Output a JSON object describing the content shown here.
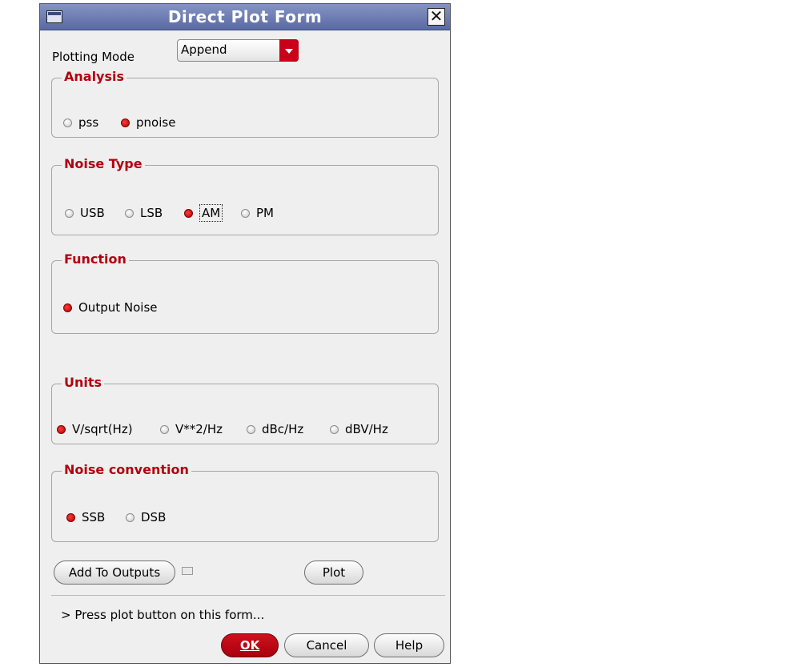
{
  "window": {
    "title": "Direct Plot Form",
    "close_symbol": "✕"
  },
  "plotting_mode": {
    "label": "Plotting Mode",
    "value": "Append"
  },
  "analysis": {
    "title": "Analysis",
    "options": [
      {
        "label": "pss",
        "selected": false
      },
      {
        "label": "pnoise",
        "selected": true
      }
    ]
  },
  "noise_type": {
    "title": "Noise Type",
    "options": [
      {
        "label": "USB",
        "selected": false
      },
      {
        "label": "LSB",
        "selected": false
      },
      {
        "label": "AM",
        "selected": true
      },
      {
        "label": "PM",
        "selected": false
      }
    ]
  },
  "function": {
    "title": "Function",
    "options": [
      {
        "label": "Output Noise",
        "selected": true
      }
    ]
  },
  "units": {
    "title": "Units",
    "options": [
      {
        "label": "V/sqrt(Hz)",
        "selected": true
      },
      {
        "label": "V**2/Hz",
        "selected": false
      },
      {
        "label": "dBc/Hz",
        "selected": false
      },
      {
        "label": "dBV/Hz",
        "selected": false
      }
    ]
  },
  "noise_convention": {
    "title": "Noise convention",
    "options": [
      {
        "label": "SSB",
        "selected": true
      },
      {
        "label": "DSB",
        "selected": false
      }
    ]
  },
  "buttons": {
    "add_to_outputs": "Add To Outputs",
    "plot": "Plot",
    "ok": "OK",
    "cancel": "Cancel",
    "help": "Help"
  },
  "status": "> Press plot button on this form...",
  "colors": {
    "accent_red": "#b3000f",
    "title_bar": "#6a7ab0"
  }
}
